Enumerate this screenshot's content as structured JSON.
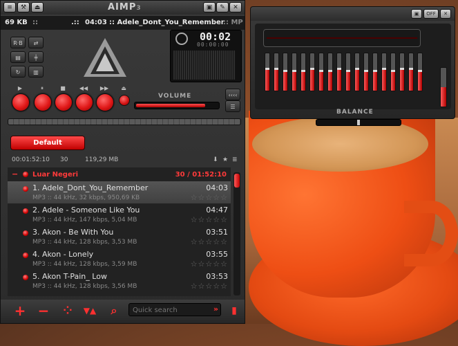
{
  "main_window": {
    "title_logo": "AIMP",
    "title_logo_sup": "3",
    "title_buttons": [
      "≡",
      "⚒",
      "⏏"
    ],
    "window_buttons": [
      "▣",
      "✎",
      "✕"
    ],
    "info": {
      "bitrate_left": "69 KB",
      "bitrate_icon": "::",
      "elapsed_prefix": ".::",
      "elapsed": "04:03",
      "now_playing": ":: Adele_Dont_You_Remember",
      "tag": ":: MP"
    },
    "timer_main": "00:02",
    "timer_sub": "00:00:00",
    "controls_labels": [
      "▶",
      "⏸",
      "■",
      "◀◀",
      "▶▶",
      "⏏"
    ],
    "volume_label": "VOLUME",
    "volume_level": 0.85
  },
  "playlist": {
    "tab_label": "Default",
    "stats": {
      "duration": "00:01:52:10",
      "count": "30",
      "size": "119,29 MB"
    },
    "group": {
      "name": "Luar Negeri",
      "info": "30 / 01:52:10"
    },
    "tracks": [
      {
        "title": "1. Adele_Dont_You_Remember",
        "duration": "04:03",
        "meta": "MP3 :: 44 kHz, 32 kbps, 950,69 KB",
        "stars": "☆☆☆☆☆",
        "selected": true
      },
      {
        "title": "2. Adele - Someone Like You",
        "duration": "04:47",
        "meta": "MP3 :: 44 kHz, 147 kbps, 5,04 MB",
        "stars": "☆☆☆☆☆",
        "selected": false
      },
      {
        "title": "3. Akon - Be With You",
        "duration": "03:51",
        "meta": "MP3 :: 44 kHz, 128 kbps, 3,53 MB",
        "stars": "☆☆☆☆☆",
        "selected": false
      },
      {
        "title": "4. Akon - Lonely",
        "duration": "03:55",
        "meta": "MP3 :: 44 kHz, 128 kbps, 3,59 MB",
        "stars": "☆☆☆☆☆",
        "selected": false
      },
      {
        "title": "5. Akon T-Pain_ Low",
        "duration": "03:53",
        "meta": "MP3 :: 44 kHz, 128 kbps, 3,56 MB",
        "stars": "☆☆☆☆☆",
        "selected": false
      }
    ]
  },
  "bottom_bar": {
    "add_icon": "+",
    "remove_icon": "−",
    "sort_icon": "⁘",
    "move_icon": "▼▲",
    "find_icon": "⌕",
    "search_placeholder": "Quick search",
    "search_go": "»",
    "file_icon": "▮"
  },
  "equalizer": {
    "off_label": "OFF",
    "balance_label": "BALANCE",
    "band_levels": [
      0.55,
      0.55,
      0.5,
      0.5,
      0.5,
      0.55,
      0.5,
      0.5,
      0.55,
      0.5,
      0.55,
      0.5,
      0.5,
      0.55,
      0.5,
      0.55,
      0.55,
      0.5
    ],
    "preamp_level": 0.5,
    "balance": 0.5
  },
  "colors": {
    "accent": "#e01818",
    "panel": "#2a2a2a"
  }
}
